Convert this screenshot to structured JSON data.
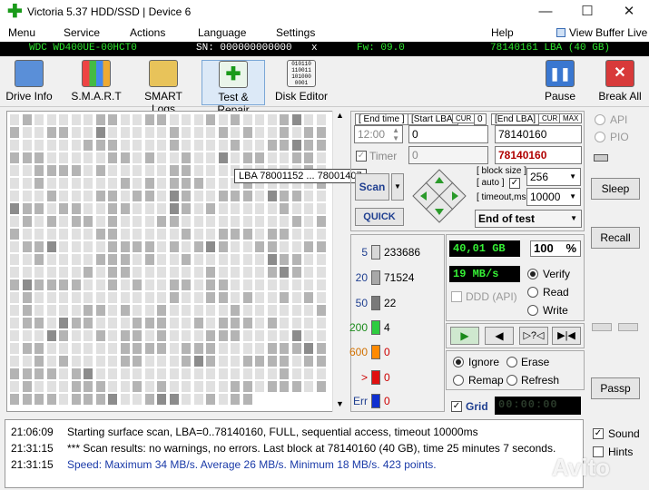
{
  "window": {
    "title": "Victoria 5.37 HDD/SSD | Device 6"
  },
  "menu": {
    "items": [
      "Menu",
      "Service",
      "Actions",
      "Language",
      "Settings"
    ],
    "help": "Help",
    "view_buffer": "View Buffer Live"
  },
  "drive": {
    "model": "WDC WD400UE-00HCT0",
    "serial": "SN: 000000000000",
    "close": "x",
    "firmware": "Fw: 09.0",
    "lba": "78140161 LBA (40 GB)"
  },
  "toolbar": {
    "drive_info": "Drive Info",
    "smart": "S.M.A.R.T",
    "smart_logs": "SMART Logs",
    "test_repair": "Test & Repair",
    "disk_editor": "Disk Editor",
    "pause": "Pause",
    "break_all": "Break All"
  },
  "tooltip": "LBA  78001152 ... 78001407",
  "scan": {
    "end_time_label": "[ End time ]",
    "start_lba_label": "[Start LBA]",
    "cur1": "CUR",
    "zero": "0",
    "end_lba_label": "[End LBA]",
    "cur2": "CUR",
    "max": "MAX",
    "time_value": "12:00",
    "start_lba": "0",
    "end_lba": "78140160",
    "timer_label": "Timer",
    "timer_value": "0",
    "end_lba_red": "78140160",
    "scan_btn": "Scan",
    "quick_btn": "QUICK",
    "block_size_label": "[ block size ]",
    "auto_label": "[ auto ]",
    "block_size": "256",
    "timeout_label": "[ timeout,ms ]",
    "timeout": "10000",
    "end_mode": "End of test"
  },
  "counters": [
    {
      "label": "5",
      "count": "233686",
      "color": "#d8d8d8"
    },
    {
      "label": "20",
      "count": "71524",
      "color": "#a8a8a8"
    },
    {
      "label": "50",
      "count": "22",
      "color": "#7a7a7a"
    },
    {
      "label": "200",
      "count": "4",
      "color": "#2ecc40"
    },
    {
      "label": "600",
      "count": "0",
      "color": "#ff8a00"
    },
    {
      "label": ">",
      "count": "0",
      "color": "#e01010"
    },
    {
      "label": "Err",
      "count": "0",
      "color": "#1030d0"
    }
  ],
  "stats": {
    "gb": "40,01 GB",
    "percent": "100",
    "percent_sign": "%",
    "speed": "19 MB/s",
    "ddd": "DDD (API)",
    "verify": "Verify",
    "read": "Read",
    "write": "Write"
  },
  "actions": {
    "ignore": "Ignore",
    "erase": "Erase",
    "remap": "Remap",
    "refresh": "Refresh",
    "grid": "Grid",
    "timer_display": "00:00:00"
  },
  "side": {
    "api": "API",
    "pio": "PIO",
    "sleep": "Sleep",
    "recall": "Recall",
    "passp": "Passp",
    "sound": "Sound",
    "hints": "Hints"
  },
  "log": [
    {
      "time": "21:06:09",
      "text": "Starting surface scan, LBA=0..78140160, FULL, sequential access, timeout 10000ms",
      "color": "#000000"
    },
    {
      "time": "21:31:15",
      "text": "*** Scan results: no warnings, no errors. Last block at 78140160 (40 GB), time 25 minutes 7 seconds.",
      "color": "#000000"
    },
    {
      "time": "21:31:15",
      "text": "Speed: Maximum 34 MB/s. Average 26 MB/s. Minimum 18 MB/s. 423 points.",
      "color": "#1a3aa8"
    }
  ],
  "watermark": "Avito"
}
